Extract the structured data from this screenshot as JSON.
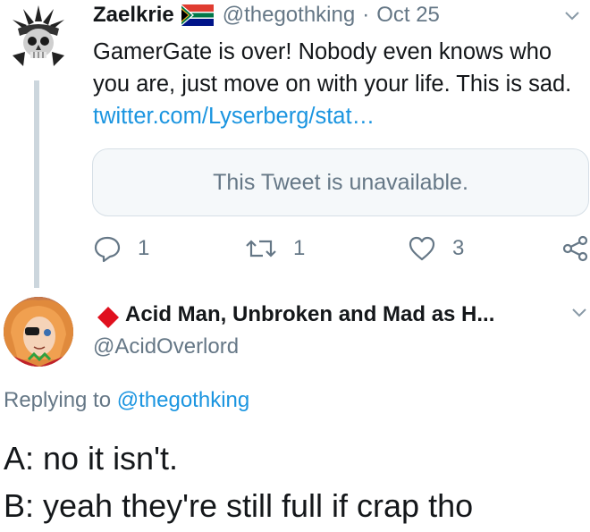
{
  "tweet1": {
    "display_name": "Zaelkrie",
    "flag_icon": "south-africa-flag-icon",
    "handle": "@thegothking",
    "separator": "·",
    "date": "Oct 25",
    "text": "GamerGate is over! Nobody even knows who you are, just move on with your life. This is sad.",
    "link": "twitter.com/Lyserberg/stat…",
    "quote_text": "This Tweet is unavailable.",
    "actions": {
      "reply_count": "1",
      "retweet_count": "1",
      "like_count": "3"
    }
  },
  "tweet2": {
    "display_name": "Acid Man, Unbroken and Mad as H...",
    "handle": "@AcidOverlord",
    "diamond_color": "#e0101e",
    "replying_prefix": "Replying to",
    "replying_handle": "@thegothking"
  },
  "caption": {
    "line_a": "A: no it isn't.",
    "line_b": "B: yeah they're still full if crap tho"
  },
  "colors": {
    "link": "#1b95e0",
    "muted": "#657786",
    "thread_line": "#ccd6dd"
  }
}
